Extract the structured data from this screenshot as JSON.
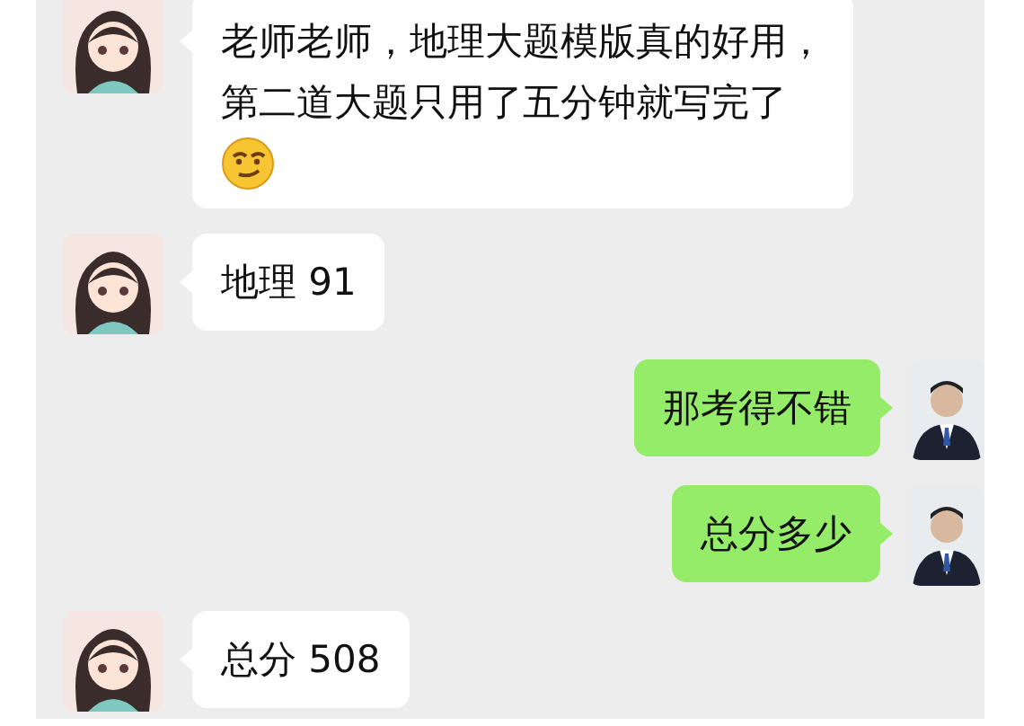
{
  "messages": [
    {
      "kind": "received",
      "lines": [
        "老师老师，地理大题模版真的好用，",
        "第二道大题只用了五分钟就写完了"
      ],
      "emoji": true
    },
    {
      "kind": "received",
      "lines": [
        "地理 91"
      ]
    },
    {
      "kind": "sent",
      "lines": [
        "那考得不错"
      ]
    },
    {
      "kind": "sent",
      "lines": [
        "总分多少"
      ]
    },
    {
      "kind": "received",
      "lines": [
        "总分 508"
      ]
    }
  ]
}
